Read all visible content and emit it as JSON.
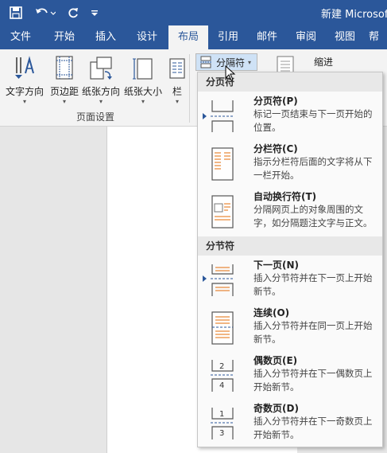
{
  "titlebar": {
    "doc_title": "新建 Microsoft"
  },
  "ribbon_tabs": [
    "文件",
    "开始",
    "插入",
    "设计",
    "布局",
    "引用",
    "邮件",
    "审阅",
    "视图",
    "帮"
  ],
  "active_tab": "布局",
  "ribbon": {
    "text_direction": "文字方向",
    "margins": "边距",
    "margins_prefix": "页",
    "orientation": "纸张方向",
    "size": "纸张大小",
    "columns": "栏",
    "group_label": "页面设置",
    "breaks": "分隔符",
    "indent": "缩进"
  },
  "menu": {
    "page_breaks_header": "分页符",
    "section_breaks_header": "分节符",
    "items": [
      {
        "title": "分页符(P)",
        "desc": "标记一页结束与下一页开始的位置。"
      },
      {
        "title": "分栏符(C)",
        "desc": "指示分栏符后面的文字将从下一栏开始。"
      },
      {
        "title": "自动换行符(T)",
        "desc": "分隔网页上的对象周围的文字，如分隔题注文字与正文。"
      },
      {
        "title": "下一页(N)",
        "desc": "插入分节符并在下一页上开始新节。"
      },
      {
        "title": "连续(O)",
        "desc": "插入分节符并在同一页上开始新节。"
      },
      {
        "title": "偶数页(E)",
        "desc": "插入分节符并在下一偶数页上开始新节。"
      },
      {
        "title": "奇数页(D)",
        "desc": "插入分节符并在下一奇数页上开始新节。"
      }
    ]
  },
  "icons": {
    "save": "save-icon",
    "undo": "undo-icon",
    "redo": "redo-icon",
    "customize": "customize-quick-access-icon"
  },
  "colors": {
    "brand": "#2b579a",
    "accent": "#e36c0a"
  }
}
